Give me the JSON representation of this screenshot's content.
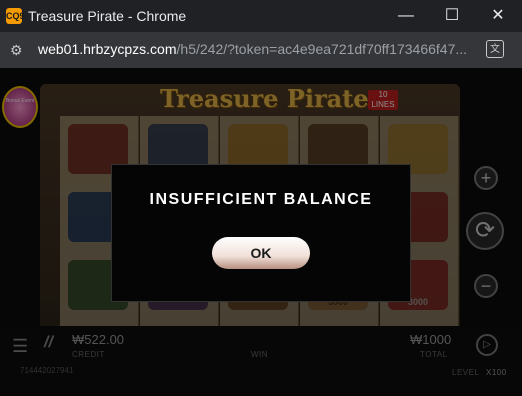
{
  "window": {
    "title": "Treasure Pirate - Chrome",
    "app_icon_text": "CQ9",
    "controls": {
      "minimize": "—",
      "maximize": "☐",
      "close": "✕"
    }
  },
  "addressbar": {
    "url_host": "web01.hrbzycpzs.com",
    "url_rest": "/h5/242/?token=ac4e9ea721df70ff173466f47..."
  },
  "game": {
    "logo_text": "Treasure Pirate",
    "lines_badge": "10 LINES",
    "promo_text": "Bonus Event",
    "reel_symbols": {
      "row3_col4": "3000",
      "row3_col5": "3000"
    },
    "side_buttons": {
      "plus": "+",
      "spin": "⟳",
      "minus": "−"
    }
  },
  "modal": {
    "message": "INSUFFICIENT BALANCE",
    "ok_label": "OK"
  },
  "footer": {
    "credit_value": "₩522.00",
    "credit_label": "CREDIT",
    "win_label": "WIN",
    "total_value": "₩1000",
    "total_label": "TOTAL",
    "player_id": "714442027941",
    "level_label": "LEVEL",
    "level_value": "X100"
  },
  "colors": {
    "modal_bg": "#050505",
    "ok_button": "#f0e0d8",
    "logo_gold": "#e6b446"
  }
}
